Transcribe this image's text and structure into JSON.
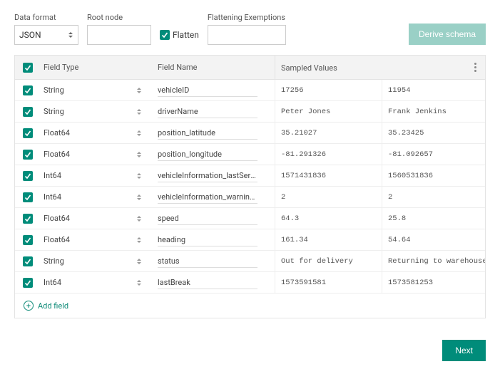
{
  "controls": {
    "data_format_label": "Data format",
    "data_format_value": "JSON",
    "root_node_label": "Root node",
    "root_node_value": "",
    "flatten_label": "Flatten",
    "flatten_checked": true,
    "exemptions_label": "Flattening Exemptions",
    "exemptions_value": "",
    "derive_schema_label": "Derive schema"
  },
  "table": {
    "header_field_type": "Field Type",
    "header_field_name": "Field Name",
    "header_sampled": "Sampled Values",
    "rows": [
      {
        "checked": true,
        "type": "String",
        "name": "vehicleID",
        "s1": "17256",
        "s2": "11954"
      },
      {
        "checked": true,
        "type": "String",
        "name": "driverName",
        "s1": "Peter Jones",
        "s2": "Frank Jenkins"
      },
      {
        "checked": true,
        "type": "Float64",
        "name": "position_latitude",
        "s1": "35.21027",
        "s2": "35.23425"
      },
      {
        "checked": true,
        "type": "Float64",
        "name": "position_longitude",
        "s1": "-81.291326",
        "s2": "-81.092657"
      },
      {
        "checked": true,
        "type": "Int64",
        "name": "vehicleInformation_lastService",
        "s1": "1571431836",
        "s2": "1560531836"
      },
      {
        "checked": true,
        "type": "Int64",
        "name": "vehicleInformation_warningCodes",
        "s1": "2",
        "s2": "2"
      },
      {
        "checked": true,
        "type": "Float64",
        "name": "speed",
        "s1": "64.3",
        "s2": "25.8"
      },
      {
        "checked": true,
        "type": "Float64",
        "name": "heading",
        "s1": "161.34",
        "s2": "54.64"
      },
      {
        "checked": true,
        "type": "String",
        "name": "status",
        "s1": "Out for delivery",
        "s2": "Returning to warehouse"
      },
      {
        "checked": true,
        "type": "Int64",
        "name": "lastBreak",
        "s1": "1573591581",
        "s2": "1573581253"
      }
    ],
    "add_field_label": "Add field"
  },
  "footer": {
    "next_label": "Next"
  }
}
